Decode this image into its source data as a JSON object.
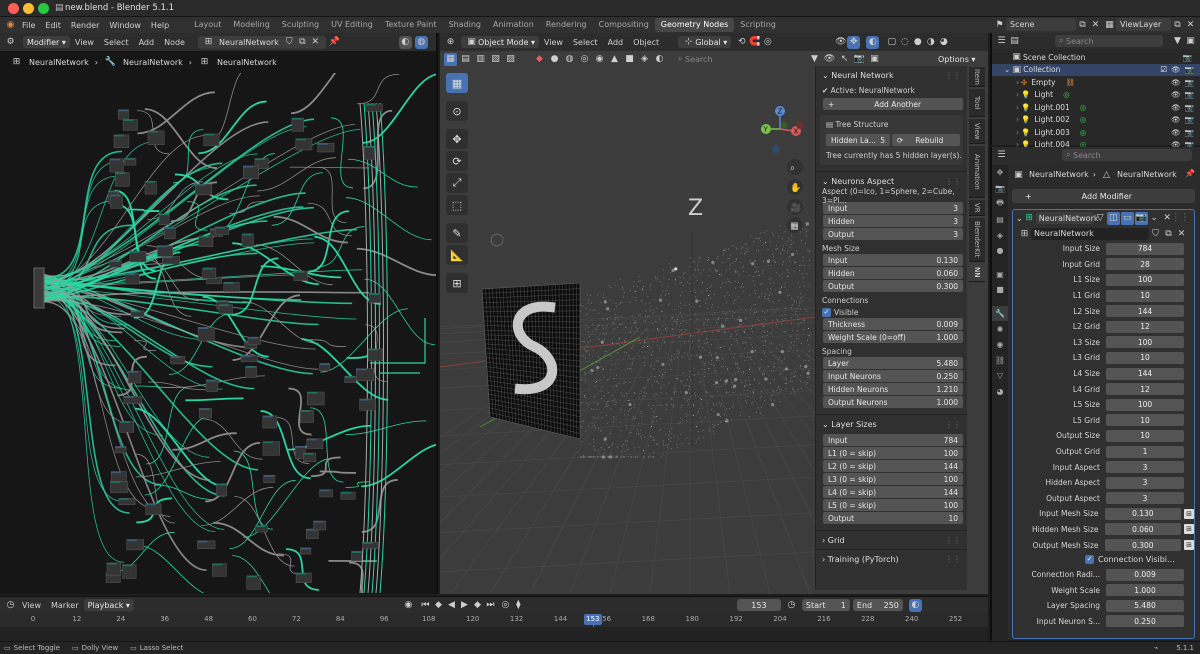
{
  "window_title": "new.blend - Blender 5.1.1",
  "menus": [
    "File",
    "Edit",
    "Render",
    "Window",
    "Help"
  ],
  "workspaces": [
    {
      "label": "Layout"
    },
    {
      "label": "Modeling"
    },
    {
      "label": "Sculpting"
    },
    {
      "label": "UV Editing"
    },
    {
      "label": "Texture Paint"
    },
    {
      "label": "Shading"
    },
    {
      "label": "Animation"
    },
    {
      "label": "Rendering"
    },
    {
      "label": "Compositing"
    },
    {
      "label": "Geometry Nodes",
      "active": true
    },
    {
      "label": "Scripting"
    }
  ],
  "scene": {
    "label": "Scene",
    "viewlayer": "ViewLayer"
  },
  "node_editor": {
    "mode": "Modifier",
    "menus": [
      "View",
      "Select",
      "Add",
      "Node"
    ],
    "tree_name": "NeuralNetwork",
    "breadcrumbs": [
      "NeuralNetwork",
      "NeuralNetwork",
      "NeuralNetwork"
    ]
  },
  "viewport": {
    "mode": "Object Mode",
    "menus": [
      "View",
      "Select",
      "Add",
      "Object"
    ],
    "transform": "Global",
    "search_placeholder": "Search",
    "options_label": "Options",
    "axis_label": "Z",
    "gizmo": {
      "x": "X",
      "y": "Y",
      "z": "Z"
    },
    "tabs": [
      "Item",
      "Tool",
      "View",
      "Animation",
      "VR",
      "BlenderKit",
      "NN"
    ]
  },
  "npanel": {
    "neural_network": {
      "title": "Neural Network",
      "active_label": "Active: NeuralNetwork",
      "add_another": "Add Another",
      "tree_structure": "Tree Structure",
      "hidden_label": "Hidden La...",
      "hidden_value": "5",
      "rebuild": "Rebuild",
      "info": "Tree currently has 5 hidden layer(s)."
    },
    "neurons_aspect": {
      "title": "Neurons Aspect",
      "aspect_label": "Aspect (0=Ico, 1=Sphere, 2=Cube, 3=Pl...",
      "aspect": [
        {
          "label": "Input",
          "value": "3"
        },
        {
          "label": "Hidden",
          "value": "3"
        },
        {
          "label": "Output",
          "value": "3"
        }
      ],
      "mesh_size_label": "Mesh Size",
      "mesh_size": [
        {
          "label": "Input",
          "value": "0.130"
        },
        {
          "label": "Hidden",
          "value": "0.060"
        },
        {
          "label": "Output",
          "value": "0.300"
        }
      ],
      "connections_label": "Connections",
      "visible_label": "Visible",
      "connections": [
        {
          "label": "Thickness",
          "value": "0.009"
        },
        {
          "label": "Weight Scale (0=off)",
          "value": "1.000"
        }
      ],
      "spacing_label": "Spacing",
      "spacing": [
        {
          "label": "Layer",
          "value": "5.480"
        },
        {
          "label": "Input Neurons",
          "value": "0.250"
        },
        {
          "label": "Hidden Neurons",
          "value": "1.210"
        },
        {
          "label": "Output Neurons",
          "value": "1.000"
        }
      ]
    },
    "layer_sizes": {
      "title": "Layer Sizes",
      "rows": [
        {
          "label": "Input",
          "value": "784"
        },
        {
          "label": "L1 (0 = skip)",
          "value": "100"
        },
        {
          "label": "L2 (0 = skip)",
          "value": "144"
        },
        {
          "label": "L3 (0 = skip)",
          "value": "100"
        },
        {
          "label": "L4 (0 = skip)",
          "value": "144"
        },
        {
          "label": "L5 (0 = skip)",
          "value": "100"
        },
        {
          "label": "Output",
          "value": "10"
        }
      ]
    },
    "grid_label": "Grid",
    "training_label": "Training (PyTorch)"
  },
  "outliner": {
    "search_placeholder": "Search",
    "scene_collection": "Scene Collection",
    "collection": "Collection",
    "items": [
      "Empty",
      "Light",
      "Light.001",
      "Light.002",
      "Light.003",
      "Light.004"
    ]
  },
  "properties": {
    "search_placeholder": "Search",
    "object_name": "NeuralNetwork",
    "object_name2": "NeuralNetwork",
    "add_modifier": "Add Modifier",
    "modifier_name": "NeuralNetwork",
    "node_group": "NeuralNetwork",
    "rows": [
      {
        "label": "Input Size",
        "value": "784"
      },
      {
        "label": "Input Grid",
        "value": "28"
      },
      {
        "label": "L1 Size",
        "value": "100"
      },
      {
        "label": "L1 Grid",
        "value": "10"
      },
      {
        "label": "L2 Size",
        "value": "144"
      },
      {
        "label": "L2 Grid",
        "value": "12"
      },
      {
        "label": "L3 Size",
        "value": "100"
      },
      {
        "label": "L3 Grid",
        "value": "10"
      },
      {
        "label": "L4 Size",
        "value": "144"
      },
      {
        "label": "L4 Grid",
        "value": "12"
      },
      {
        "label": "L5 Size",
        "value": "100"
      },
      {
        "label": "L5 Grid",
        "value": "10"
      },
      {
        "label": "Output Size",
        "value": "10"
      },
      {
        "label": "Output Grid",
        "value": "1"
      },
      {
        "label": "Input Aspect",
        "value": "3"
      },
      {
        "label": "Hidden Aspect",
        "value": "3"
      },
      {
        "label": "Output Aspect",
        "value": "3"
      },
      {
        "label": "Input Mesh Size",
        "value": "0.130"
      },
      {
        "label": "Hidden Mesh Size",
        "value": "0.060"
      },
      {
        "label": "Output Mesh Size",
        "value": "0.300"
      }
    ],
    "connection_visibility": "Connection Visibi...",
    "rows2": [
      {
        "label": "Connection Radi...",
        "value": "0.009"
      },
      {
        "label": "Weight Scale",
        "value": "1.000"
      },
      {
        "label": "Layer Spacing",
        "value": "5.480"
      },
      {
        "label": "Input Neuron S...",
        "value": "0.250"
      }
    ]
  },
  "timeline": {
    "menus": [
      "View",
      "Marker"
    ],
    "playback": "Playback",
    "current_frame": "153",
    "start_label": "Start",
    "start": "1",
    "end_label": "End",
    "end": "250",
    "ticks": [
      "0",
      "12",
      "24",
      "36",
      "48",
      "60",
      "72",
      "84",
      "96",
      "108",
      "120",
      "132",
      "144",
      "156",
      "168",
      "180",
      "192",
      "204",
      "216",
      "228",
      "240",
      "252"
    ],
    "frame_marker": "153"
  },
  "status": {
    "select": "Select Toggle",
    "dolly": "Dolly View",
    "lasso": "Lasso Select",
    "version": "5.1.1"
  },
  "colors": {
    "accent": "#4772b3",
    "wire": "#2ad6a2",
    "active_green": "#3ad050",
    "orange": "#e8873a"
  }
}
